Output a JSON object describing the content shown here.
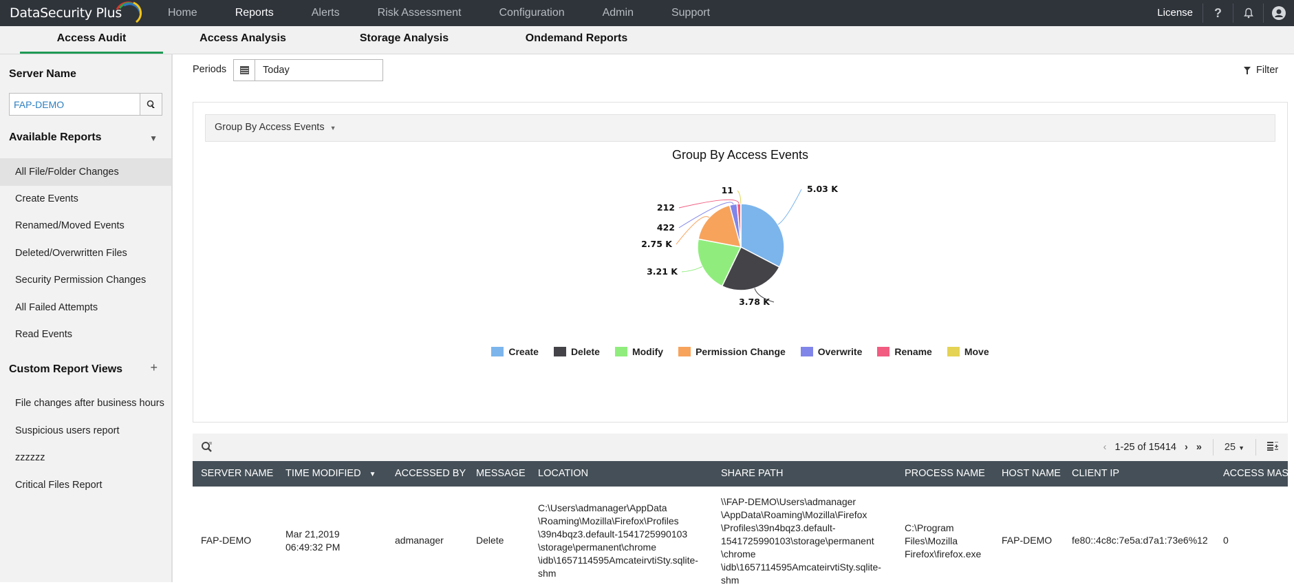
{
  "app": {
    "brand": "DataSecurity Plus",
    "nav": [
      "Home",
      "Reports",
      "Alerts",
      "Risk Assessment",
      "Configuration",
      "Admin",
      "Support"
    ],
    "nav_active": "Reports",
    "license_label": "License",
    "icons": [
      "help-icon",
      "bell-icon",
      "user-avatar-icon"
    ]
  },
  "subtabs": [
    "Access Audit",
    "Access Analysis",
    "Storage Analysis",
    "Ondemand Reports"
  ],
  "subtab_active": "Access Audit",
  "sidebar": {
    "server_name_label": "Server Name",
    "server_value": "FAP-DEMO",
    "available_reports_label": "Available Reports",
    "reports": [
      "All File/Folder Changes",
      "Create Events",
      "Renamed/Moved Events",
      "Deleted/Overwritten Files",
      "Security Permission Changes",
      "All Failed Attempts",
      "Read Events"
    ],
    "active_report": "All File/Folder Changes",
    "custom_views_label": "Custom Report Views",
    "custom_views": [
      "File changes after business hours",
      "Suspicious users report",
      "zzzzzz",
      "Critical Files Report"
    ]
  },
  "filters": {
    "periods_label": "Periods",
    "period_value": "Today",
    "filter_label": "Filter"
  },
  "chart_panel": {
    "group_by_label": "Group By Access Events"
  },
  "chart_data": {
    "type": "pie",
    "title": "Group By Access Events",
    "legend_position": "bottom",
    "categories": [
      "Create",
      "Delete",
      "Modify",
      "Permission Change",
      "Overwrite",
      "Rename",
      "Move"
    ],
    "values": [
      5030,
      3780,
      3210,
      2750,
      422,
      212,
      11
    ],
    "data_labels": [
      "5.03 K",
      "3.78 K",
      "3.21 K",
      "2.75 K",
      "422",
      "212",
      "11"
    ],
    "colors": [
      "#7cb5ec",
      "#434348",
      "#90ed7d",
      "#f7a35c",
      "#8085e9",
      "#f15c80",
      "#e4d354"
    ]
  },
  "table": {
    "pagination": {
      "range": "1-25 of 15414",
      "page_size": "25"
    },
    "columns": [
      "SERVER NAME",
      "TIME MODIFIED",
      "ACCESSED BY",
      "MESSAGE",
      "LOCATION",
      "SHARE PATH",
      "PROCESS NAME",
      "HOST NAME",
      "CLIENT IP",
      "ACCESS MASK"
    ],
    "sorted_column": "TIME MODIFIED",
    "rows": [
      {
        "server_name": "FAP-DEMO",
        "time_modified": [
          "Mar 21,2019",
          "06:49:32 PM"
        ],
        "accessed_by": "admanager",
        "message": "Delete",
        "location": [
          "C:\\Users\\admanager\\AppData",
          "\\Roaming\\Mozilla\\Firefox\\Profiles",
          "\\39n4bqz3.default-1541725990103",
          "\\storage\\permanent\\chrome",
          "\\idb\\1657114595AmcateirvtiSty.sqlite-",
          "shm"
        ],
        "share_path": [
          "\\\\FAP-DEMO\\Users\\admanager",
          "\\AppData\\Roaming\\Mozilla\\Firefox",
          "\\Profiles\\39n4bqz3.default-",
          "1541725990103\\storage\\permanent",
          "\\chrome",
          "\\idb\\1657114595AmcateirvtiSty.sqlite-",
          "shm"
        ],
        "process_name": [
          "C:\\Program",
          "Files\\Mozilla",
          "Firefox\\firefox.exe"
        ],
        "host_name": "FAP-DEMO",
        "client_ip": "fe80::4c8c:7e5a:d7a1:73e6%12",
        "access_mask": "0"
      }
    ]
  }
}
